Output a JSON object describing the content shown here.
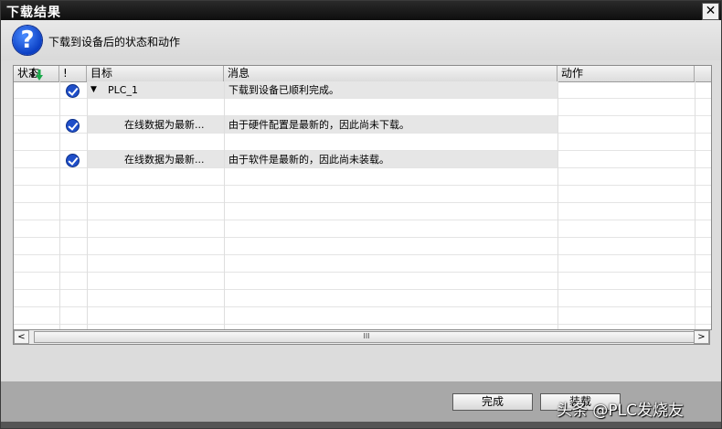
{
  "window": {
    "title": "下载结果",
    "close_glyph": "✕"
  },
  "prompt": {
    "text": "下载到设备后的状态和动作"
  },
  "table": {
    "headers": {
      "status": "状态",
      "mark": "!",
      "target": "目标",
      "message": "消息",
      "action": "动作"
    },
    "rows": [
      {
        "target": "PLC_1",
        "message": "下载到设备已顺利完成。",
        "status_icon": "download-arrows-icon",
        "check": true,
        "expand": "▼"
      },
      {
        "target": "在线数据为最新...",
        "message": "由于硬件配置是最新的，因此尚未下载。",
        "check": true
      },
      {
        "target": "在线数据为最新...",
        "message": "由于软件是最新的，因此尚未装载。",
        "check": true
      }
    ]
  },
  "scrollbar": {
    "left": "<",
    "right": ">",
    "grip": "III"
  },
  "buttons": {
    "finish": "完成",
    "load": "装载"
  },
  "watermark": "头条 @PLC发烧友",
  "colors": {
    "check": "#1f4fc9",
    "titlebar": "#1a1a1a",
    "accent": "#0b3fc4"
  }
}
